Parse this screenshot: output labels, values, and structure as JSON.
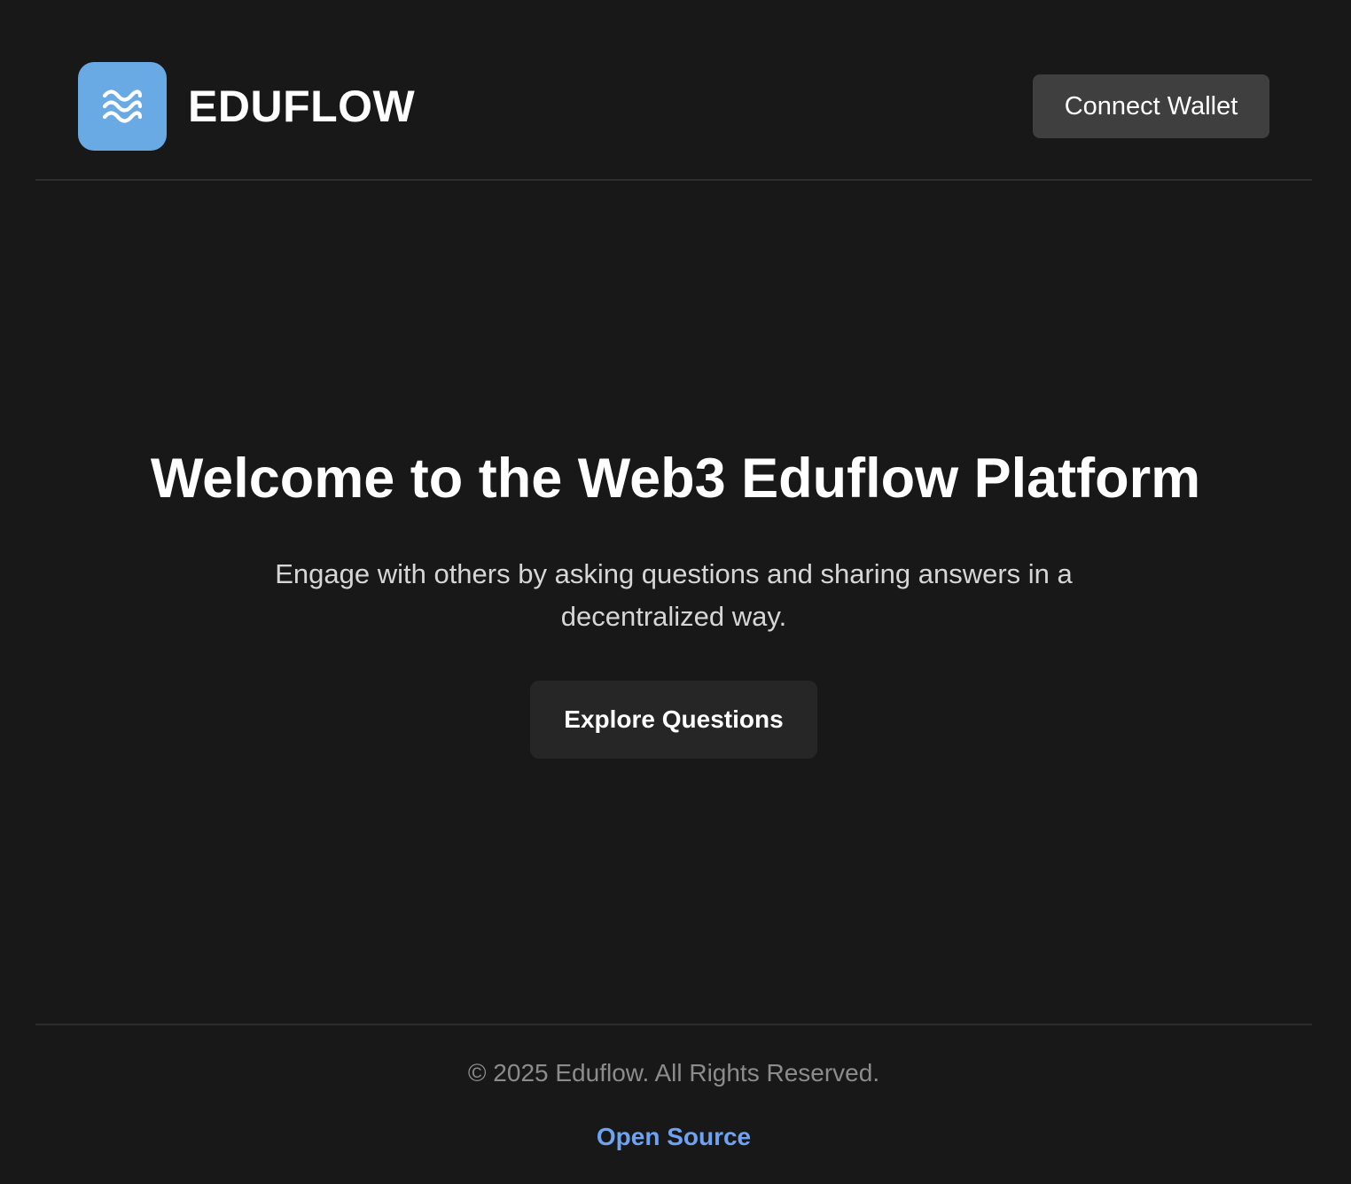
{
  "header": {
    "logo_icon": "wave-icon",
    "brand_name": "EDUFLOW",
    "connect_label": "Connect Wallet"
  },
  "hero": {
    "title": "Welcome to the Web3 Eduflow Platform",
    "subtitle": "Engage with others by asking questions and sharing answers in a decentralized way.",
    "cta_label": "Explore Questions"
  },
  "footer": {
    "copyright": "© 2025 Eduflow. All Rights Reserved.",
    "link_label": "Open Source"
  },
  "colors": {
    "background": "#181818",
    "logo_bg": "#6aaae4",
    "link": "#6ea3f3",
    "button_secondary": "#3f3f3f"
  }
}
